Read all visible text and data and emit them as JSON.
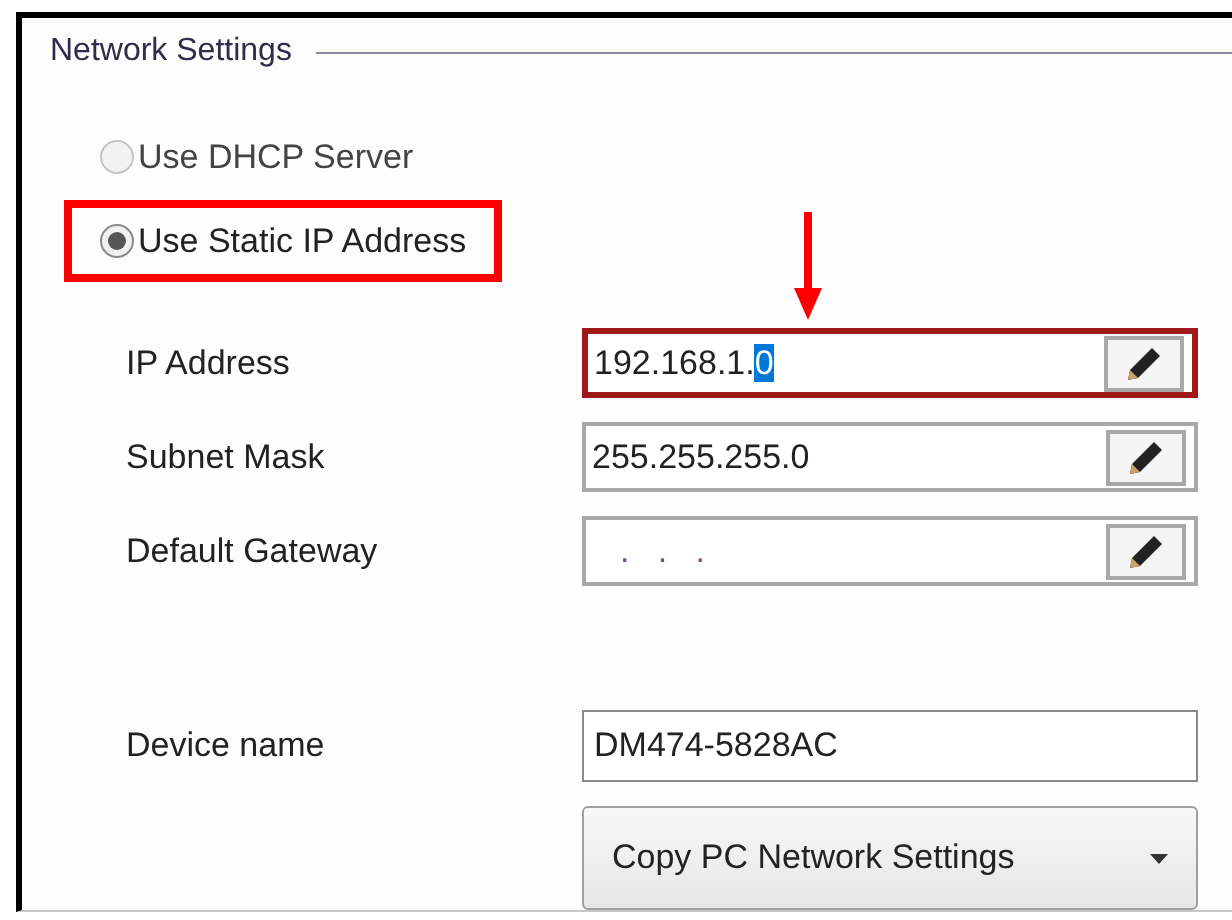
{
  "group_title": "Network Settings",
  "radios": [
    {
      "label": "Use DHCP Server",
      "selected": false,
      "disabled": true,
      "highlighted": false
    },
    {
      "label": "Use Static IP Address",
      "selected": true,
      "disabled": false,
      "highlighted": true
    }
  ],
  "fields": [
    {
      "label": "IP Address",
      "value": "192.168.1.",
      "selected_text": "0",
      "focused": true
    },
    {
      "label": "Subnet Mask",
      "value": "255.255.255.0",
      "focused": false
    },
    {
      "label": "Default Gateway",
      "value": ".   .   .",
      "focused": false
    }
  ],
  "device_name": {
    "label": "Device name",
    "value": "DM474-5828AC"
  },
  "copy_button": {
    "label": "Copy PC Network Settings"
  }
}
